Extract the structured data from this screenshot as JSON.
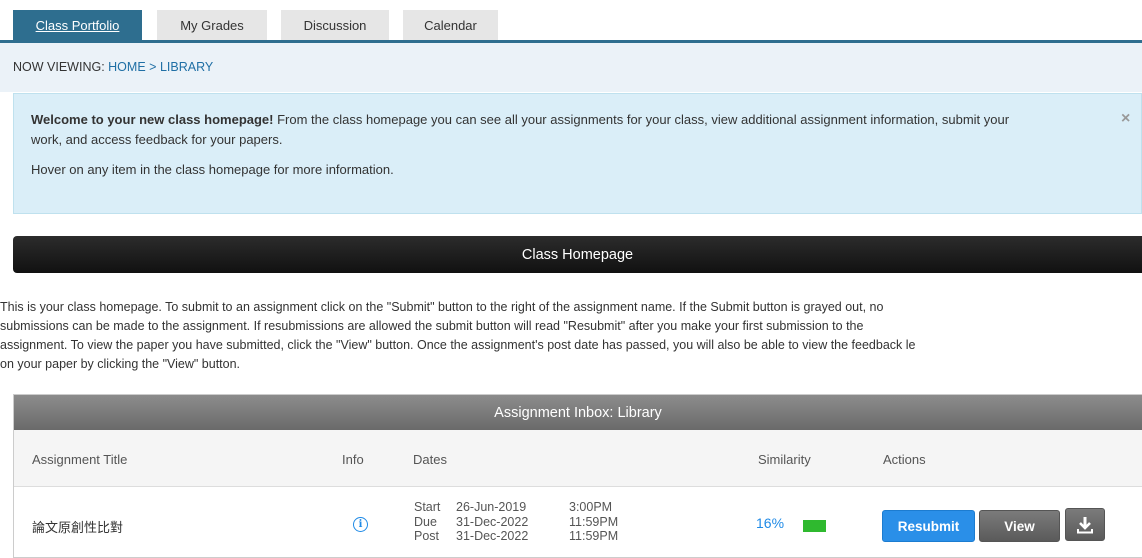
{
  "tabs": [
    {
      "label": "Class Portfolio",
      "active": true
    },
    {
      "label": "My Grades",
      "active": false
    },
    {
      "label": "Discussion",
      "active": false
    },
    {
      "label": "Calendar",
      "active": false
    }
  ],
  "breadcrumb": {
    "prefix": "NOW VIEWING:",
    "home": "HOME",
    "separator": ">",
    "current": "LIBRARY"
  },
  "welcome": {
    "bold": "Welcome to your new class homepage!",
    "text": " From the class homepage you can see all your assignments for your class, view additional assignment information, submit your work, and access feedback for your papers.",
    "hover_text": "Hover on any item in the class homepage for more information.",
    "close": "×"
  },
  "class_homepage": {
    "title": "Class Homepage",
    "intro_lines": [
      "This is your class homepage. To submit to an assignment click on the \"Submit\" button to the right of the assignment name. If the Submit button is grayed out, no",
      "submissions can be made to the assignment. If resubmissions are allowed the submit button will read \"Resubmit\" after you make your first submission to the",
      "assignment. To view the paper you have submitted, click the \"View\" button. Once the assignment's post date has passed, you will also be able to view the feedback le",
      "on your paper by clicking the \"View\" button."
    ]
  },
  "inbox": {
    "title": "Assignment Inbox: Library",
    "columns": {
      "title": "Assignment Title",
      "info": "Info",
      "dates": "Dates",
      "similarity": "Similarity",
      "actions": "Actions"
    },
    "rows": [
      {
        "title": "論文原創性比對",
        "info_icon": "info-circle-icon",
        "dates": [
          {
            "label": "Start",
            "date": "26-Jun-2019",
            "time": "3:00PM"
          },
          {
            "label": "Due",
            "date": "31-Dec-2022",
            "time": "11:59PM"
          },
          {
            "label": "Post",
            "date": "31-Dec-2022",
            "time": "11:59PM"
          }
        ],
        "similarity": "16%",
        "similarity_color": "#2fb92f",
        "resubmit_label": "Resubmit",
        "view_label": "View",
        "download_icon": "download-icon"
      }
    ]
  },
  "colors": {
    "tab_active": "#2e6e8f",
    "alert_bg": "#daeef8",
    "primary_button": "#2a8fe8",
    "link": "#1f6fa5"
  }
}
